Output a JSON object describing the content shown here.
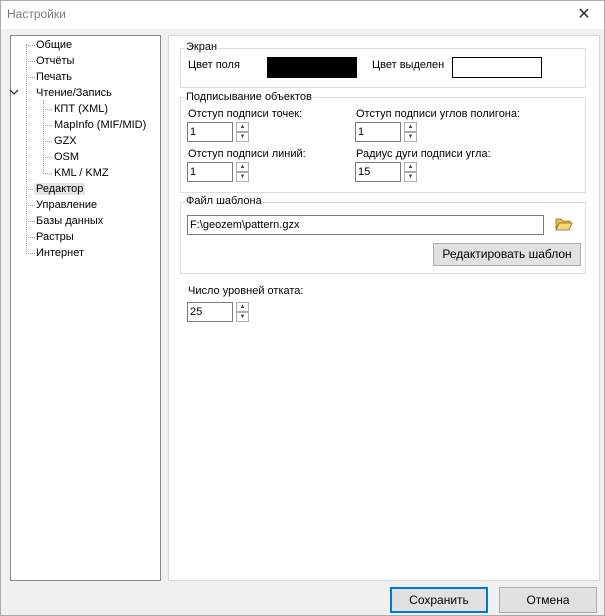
{
  "window": {
    "title": "Настройки",
    "close_glyph": "✕"
  },
  "tree": {
    "items": [
      {
        "label": "Общие"
      },
      {
        "label": "Отчёты"
      },
      {
        "label": "Печать"
      },
      {
        "label": "Чтение/Запись"
      },
      {
        "label": "КПТ (XML)"
      },
      {
        "label": "MapInfo (MIF/MID)"
      },
      {
        "label": "GZX"
      },
      {
        "label": "OSM"
      },
      {
        "label": "KML / KMZ"
      },
      {
        "label": "Редактор"
      },
      {
        "label": "Управление"
      },
      {
        "label": "Базы данных"
      },
      {
        "label": "Растры"
      },
      {
        "label": "Интернет"
      }
    ],
    "selected": "Редактор"
  },
  "screen": {
    "title": "Экран",
    "field_color_label": "Цвет поля",
    "field_color": "#000000",
    "selection_color_label": "Цвет выделен",
    "selection_color": "#ffffff"
  },
  "labels": {
    "title": "Подписывание объектов",
    "point_offset_label": "Отступ подписи точек:",
    "point_offset_value": "1",
    "polygon_angle_offset_label": "Отступ подписи углов полигона:",
    "polygon_angle_offset_value": "1",
    "line_offset_label": "Отступ подписи  линий:",
    "line_offset_value": "1",
    "arc_radius_label": "Радиус дуги подписи угла:",
    "arc_radius_value": "15"
  },
  "template": {
    "title": "Файл шаблона",
    "path": "F:\\geozem\\pattern.gzx",
    "edit_button": "Редактировать шаблон"
  },
  "undo": {
    "label": "Число уровней отката:",
    "value": "25"
  },
  "buttons": {
    "save": "Сохранить",
    "cancel": "Отмена"
  }
}
